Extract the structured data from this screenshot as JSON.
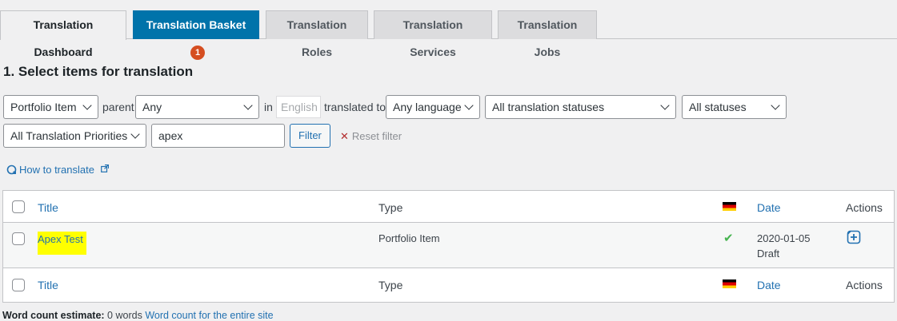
{
  "tabs": [
    {
      "label": "Translation Dashboard"
    },
    {
      "label": "Translation Basket",
      "badge": "1"
    },
    {
      "label": "Translation Roles"
    },
    {
      "label": "Translation Services"
    },
    {
      "label": "Translation Jobs"
    }
  ],
  "heading": "1. Select items for translation",
  "filters": {
    "type": "Portfolio Item",
    "parent_label": "parent",
    "parent": "Any",
    "in_label": "in",
    "source_language": "English",
    "translated_to_label": "translated to",
    "target_language": "Any language",
    "translation_status": "All translation statuses",
    "status": "All statuses",
    "priority": "All Translation Priorities",
    "search_value": "apex",
    "filter_button": "Filter",
    "reset_link": "Reset filter"
  },
  "how_to": "How to translate",
  "table": {
    "columns": {
      "title": "Title",
      "type": "Type",
      "date": "Date",
      "actions": "Actions"
    },
    "rows": [
      {
        "title": "Apex Test",
        "type": "Portfolio Item",
        "date": "2020-01-05",
        "status": "Draft"
      }
    ]
  },
  "word_count": {
    "label": "Word count estimate:",
    "value": "0 words",
    "link": "Word count for the entire site"
  },
  "colors": {
    "accent": "#0073aa",
    "badge": "#d54e21",
    "link": "#2271b1",
    "highlight": "#ffff00",
    "check": "#46b450"
  }
}
